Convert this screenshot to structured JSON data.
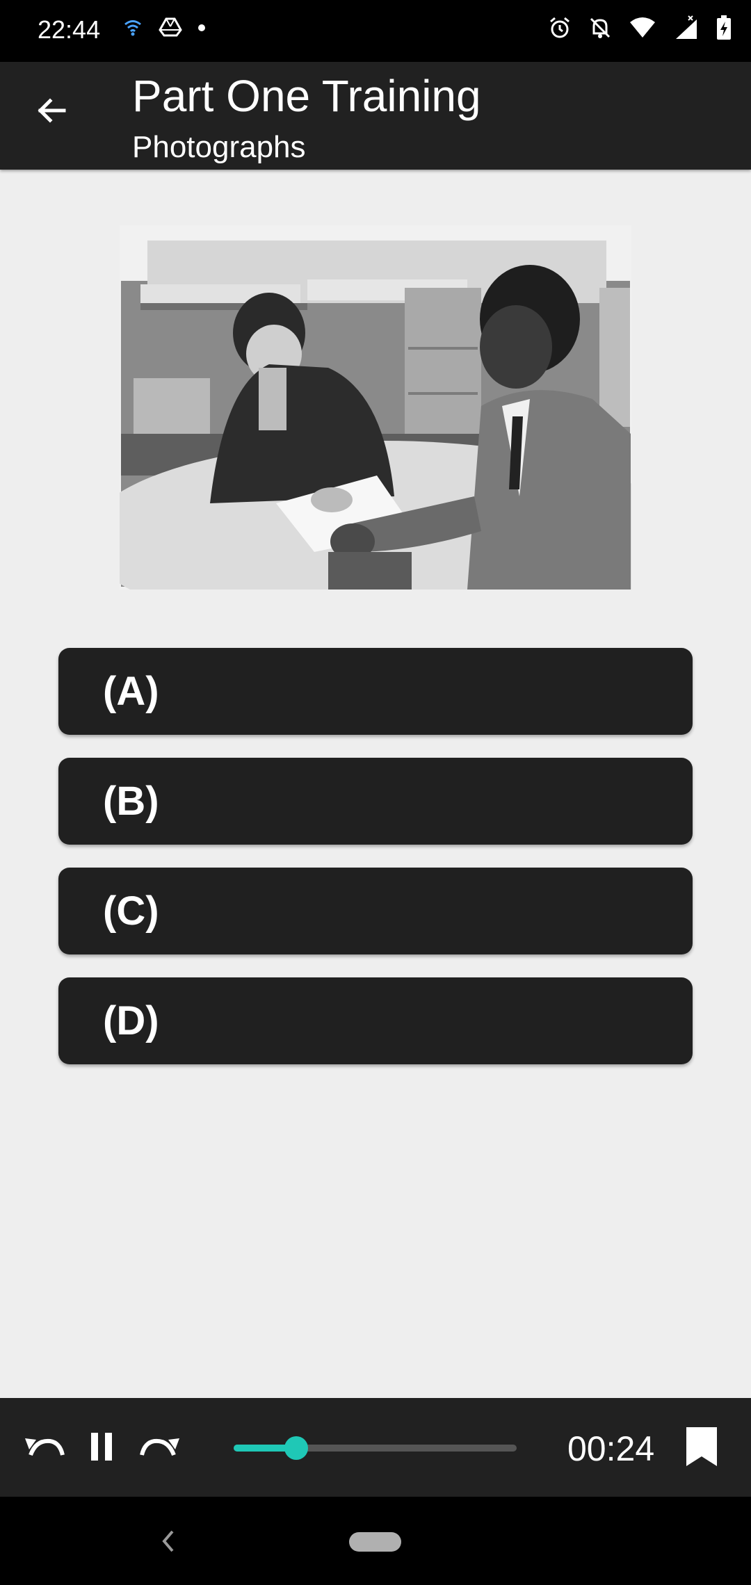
{
  "status_bar": {
    "time": "22:44",
    "left_icons": [
      "wifi-signal-icon",
      "drive-icon",
      "dot-icon"
    ],
    "right_icons": [
      "alarm-icon",
      "notifications-off-icon",
      "wifi-icon",
      "cellular-signal-icon",
      "battery-charging-icon"
    ]
  },
  "app_bar": {
    "back_icon": "arrow-left-icon",
    "title": "Part One Training",
    "subtitle": "Photographs"
  },
  "question": {
    "image": "office-meeting-photo"
  },
  "options": [
    {
      "label": "(A)"
    },
    {
      "label": "(B)"
    },
    {
      "label": "(C)"
    },
    {
      "label": "(D)"
    }
  ],
  "player": {
    "rewind_icon": "undo-icon",
    "pause_icon": "pause-icon",
    "forward_icon": "redo-icon",
    "progress_fraction": 0.22,
    "elapsed": "00:24",
    "bookmark_icon": "bookmark-icon",
    "accent_color": "#1fc8b6"
  },
  "nav_bar": {
    "back_icon": "chevron-left-icon",
    "home_icon": "home-pill-icon"
  }
}
